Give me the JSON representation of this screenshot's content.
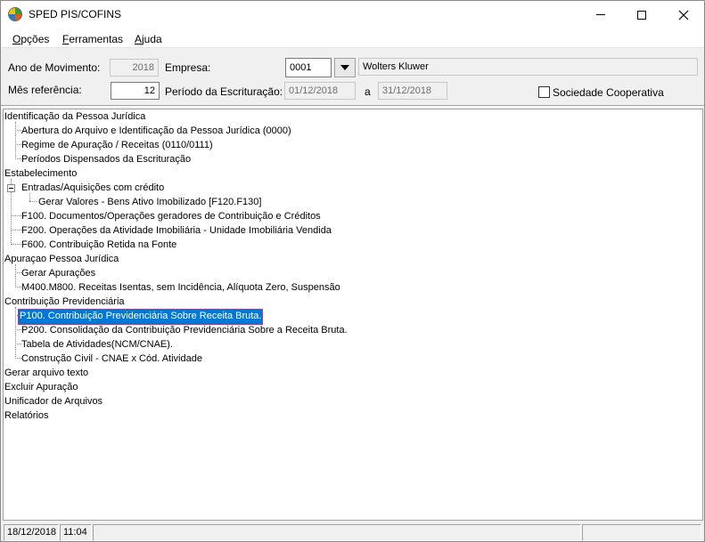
{
  "window": {
    "title": "SPED PIS/COFINS"
  },
  "menu": {
    "items": [
      {
        "label_u": "O",
        "label_rest": "pções"
      },
      {
        "label_u": "F",
        "label_rest": "erramentas"
      },
      {
        "label_u": "A",
        "label_rest": "juda"
      }
    ]
  },
  "form": {
    "ano_label": "Ano de Movimento:",
    "ano_value": "2018",
    "empresa_label": "Empresa:",
    "empresa_code": "0001",
    "empresa_name": "Wolters Kluwer",
    "mes_label": "Mês referência:",
    "mes_value": "12",
    "periodo_label": "Período da Escrituração:",
    "periodo_inicio": "01/12/2018",
    "periodo_sep": "a",
    "periodo_fim": "31/12/2018",
    "cooperativa_label": "Sociedade Cooperativa",
    "cooperativa_checked": false
  },
  "tree": {
    "identificacao": "Identificação da Pessoa Jurídica",
    "abertura": "Abertura do Arquivo e Identificação da Pessoa Jurídica (0000)",
    "regime": "Regime de Apuração / Receitas (0110/0111)",
    "periodos": "Períodos Dispensados da Escrituração",
    "estabelecimento": "Estabelecimento",
    "entradas": "Entradas/Aquisições com crédito",
    "gerar_valores": "Gerar Valores - Bens Ativo Imobilizado    [F120.F130]",
    "f100": "F100. Documentos/Operações geradores de Contribuição e Créditos",
    "f200": "F200. Operações da Atividade Imobiliária - Unidade Imobiliária Vendida",
    "f600": "F600. Contribuição Retida na Fonte",
    "apuracao": "Apuraçao Pessoa Jurídica",
    "gerar_apuracoes": "Gerar Apurações",
    "m400": "M400.M800. Receitas Isentas, sem Incidência, Alíquota Zero, Suspensão",
    "contribuicao": "Contribuição Previdenciária",
    "p100": "P100. Contribuição Previdenciária Sobre Receita Bruta.",
    "p200": "P200. Consolidação da Contribuição Previdenciária Sobre a Receita Bruta.",
    "tabela": "Tabela de Atividades(NCM/CNAE).",
    "construcao": "Construção Civil - CNAE x Cód. Atividade",
    "gerar_arquivo": "Gerar arquivo texto",
    "excluir": "Excluir Apuração",
    "unificador": "Unificador de Arquivos",
    "relatorios": "Relatórios"
  },
  "status": {
    "date": "18/12/2018",
    "time": "11:04"
  },
  "colors": {
    "selection": "#0078d7",
    "selection_outline": "#c03080"
  }
}
